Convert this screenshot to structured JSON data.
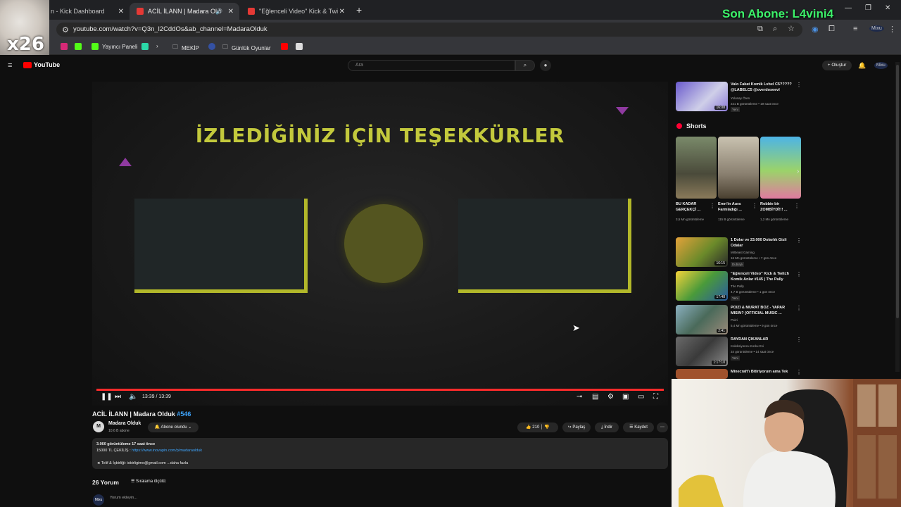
{
  "browser": {
    "tabs": [
      {
        "title": "n - Kick Dashboard",
        "active": false
      },
      {
        "title": "ACİL İLANN | Madara Oldu",
        "active": true
      },
      {
        "title": "\"Eğlenceli Video\" Kick & Twitch",
        "active": false
      }
    ],
    "new_tab_label": "+",
    "url": "youtube.com/watch?v=Q3n_l2CddOs&ab_channel=MadaraOlduk",
    "bookmarks": [
      "Yayıncı Paneli",
      "MEKİP",
      "Günlük Oyunlar"
    ]
  },
  "overlay": {
    "cat_badge": "x26",
    "last_subscriber": "Son Abone: L4vini4"
  },
  "youtube": {
    "logo": "YouTube",
    "search_placeholder": "Ara",
    "create_label": "Oluştur",
    "account_label": "Mixu"
  },
  "player": {
    "end_title": "İZLEDİĞİNİZ İÇİN TEŞEKKÜRLER",
    "time": "13:39 / 13:39",
    "progress": 1.0
  },
  "video": {
    "title": "ACİL İLANN | Madara Olduk",
    "title_tag": "#546",
    "channel_initial": "M",
    "channel": "Madara Olduk",
    "subscribers": "10,6 B abone",
    "subscribe_label": "Abone olundu",
    "likes": "210",
    "share_label": "Paylaş",
    "download_label": "İndir",
    "save_label": "Kaydet",
    "description": {
      "stats": "3.060 görüntüleme  17 saat önce",
      "line2_prefix": "15000 TL ÇEKİLİŞ :",
      "line2_link": "https://www.inovapin.com/p/madaraolduk",
      "line3": "◄ Telif & İşbirliği: isbirligimo@gmail.com   ...daha fazla"
    },
    "comment_count": "26 Yorum",
    "sort_label": "Sıralama ölçütü:",
    "comment_placeholder": "Yorum ekleyin..."
  },
  "sidebar": {
    "top_video": {
      "title": "Valo Fakat Komik Lvbel C5????? @LABELC5 @overdoseevl",
      "channel": "Yolunay Ören",
      "meta": "221 B görüntüleme • 19 saat önce",
      "badge": "Yeni",
      "duration": "16:08"
    },
    "shorts_label": "Shorts",
    "shorts": [
      {
        "title": "BU KADAR GERÇEKÇİ ...",
        "views": "3,5 Mn görüntüleme"
      },
      {
        "title": "Eren'in Aura Farmladığı ...",
        "views": "115 B görüntüleme"
      },
      {
        "title": "Robbie bir ZOMBİYDİ!!! ...",
        "views": "1,2 Mn görüntüleme"
      }
    ],
    "videos": [
      {
        "title": "1 Dolar ve 23.000 Dolarlık Gizli Odalar",
        "channel": "MrBeast Gaming",
        "meta": "16 Mn görüntüleme • 7 gün önce",
        "badge": "Dublajlı",
        "duration": "16:15"
      },
      {
        "title": "\"Eğlenceli Video\" Kick & Twitch Komik Anlar #145 | The Pally",
        "channel": "The Pally",
        "meta": "4,7 B görüntüleme • 1 gün önce",
        "badge": "Yeni",
        "duration": "17:48"
      },
      {
        "title": "POIZI & MURAT BOZ - YAPAR MISIN? (OFFICIAL MUSIC ...",
        "channel": "Poizi",
        "meta": "5,4 Mn görüntüleme • 9 gün önce",
        "badge": "",
        "duration": "2:41"
      },
      {
        "title": "RAYDAN ÇIKANLAR",
        "channel": "Koleksiyoncu Korku Evi",
        "meta": "34 görüntüleme • 14 saat önce",
        "badge": "Yeni",
        "duration": "1:17:10"
      },
      {
        "title": "Minecraft'ı Bitiriyorum ama Tek",
        "channel": "",
        "meta": "",
        "badge": "",
        "duration": ""
      }
    ]
  },
  "colors": {
    "accent": "#ff0000",
    "link": "#3ea6ff",
    "endscreen": "#c3c93c",
    "overlay_text": "#3cf26a"
  }
}
